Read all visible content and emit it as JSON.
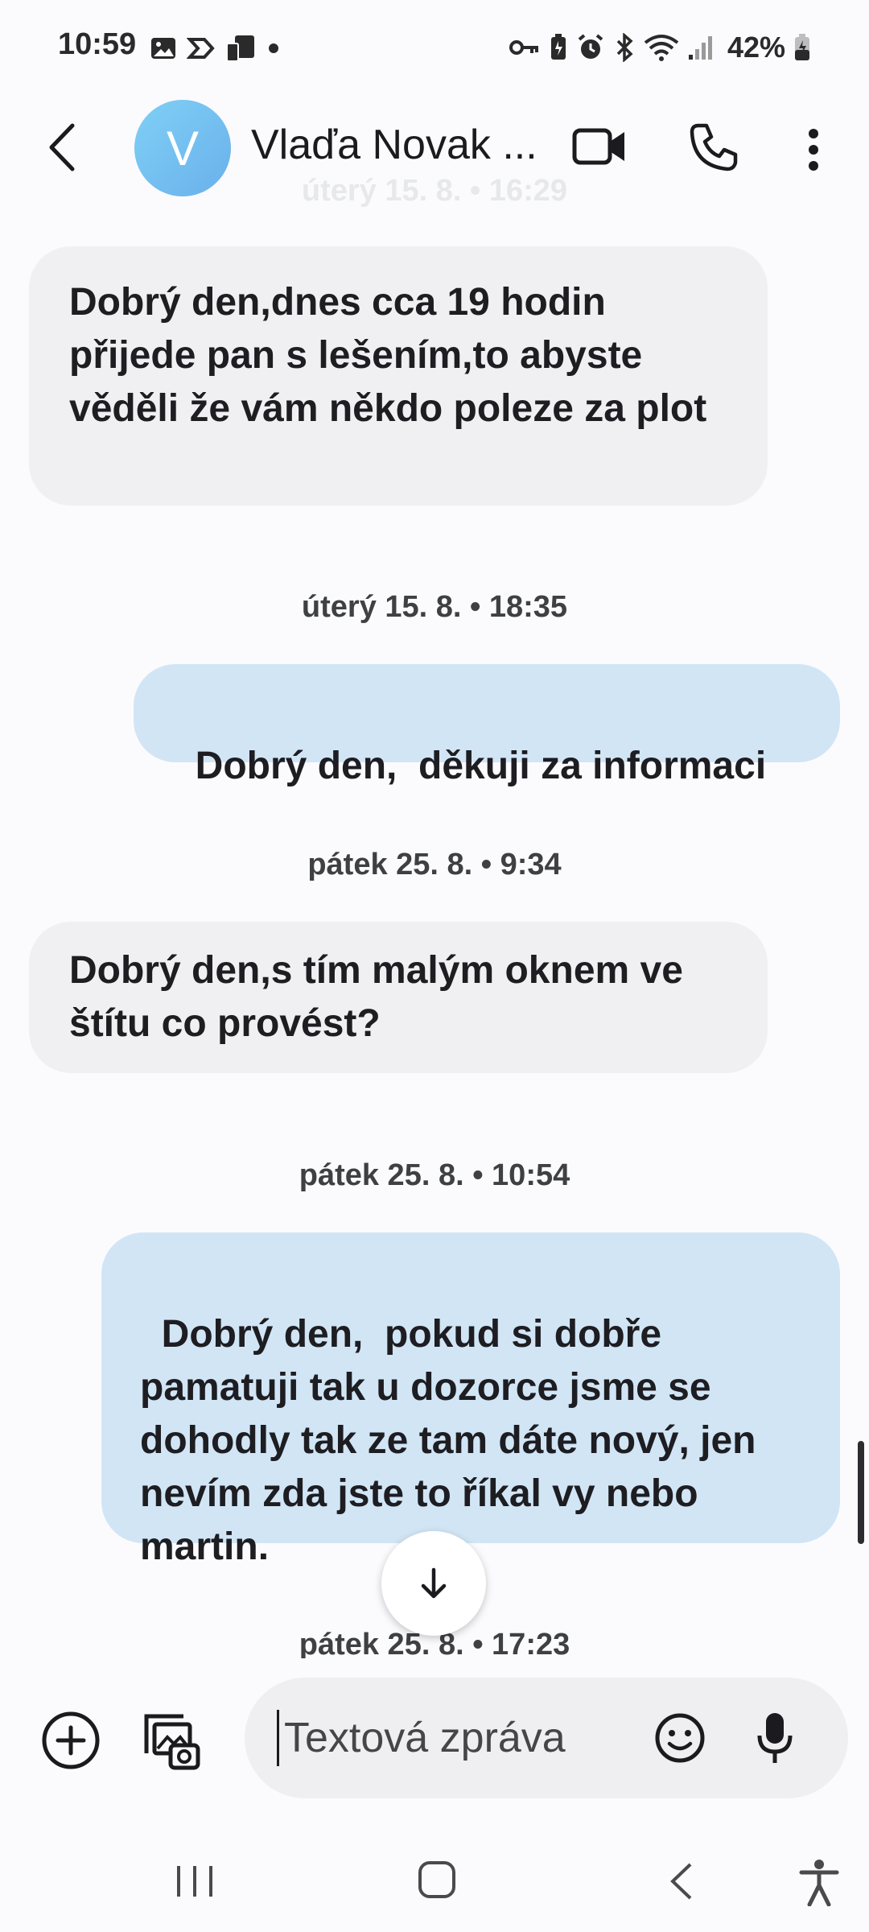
{
  "status_bar": {
    "time": "10:59",
    "battery": "42%"
  },
  "header": {
    "avatar_letter": "V",
    "contact_name": "Vlaďa Novak ...",
    "faded_date": "úterý 15. 8. • 16:29"
  },
  "messages": [
    {
      "direction": "in",
      "text": "Dobrý den,dnes cca 19 hodin přijede pan s lešením,to abyste věděli že vám někdo poleze za plot"
    },
    {
      "date": "úterý 15. 8. • 18:35"
    },
    {
      "direction": "out",
      "text": "Dobrý den,  děkuji za informaci"
    },
    {
      "date": "pátek 25. 8. • 9:34"
    },
    {
      "direction": "in",
      "text": "Dobrý den,s tím malým oknem ve štítu co provést?"
    },
    {
      "date": "pátek 25. 8. • 10:54"
    },
    {
      "direction": "out",
      "text": "Dobrý den,  pokud si dobře pamatuji tak u dozorce jsme se dohodly tak ze tam dáte nový, jen nevím zda jste to říkal vy nebo martin."
    },
    {
      "date": "pátek 25. 8. • 17:23"
    }
  ],
  "composer": {
    "placeholder": "Textová zpráva"
  },
  "icons": {
    "back": "arrow-back-icon",
    "video": "video-camera-icon",
    "call": "phone-icon",
    "more": "more-vert-icon",
    "scroll_down": "arrow-down-icon",
    "add": "add-circle-icon",
    "gallery": "gallery-camera-icon",
    "emoji": "emoji-icon",
    "mic": "microphone-icon"
  }
}
